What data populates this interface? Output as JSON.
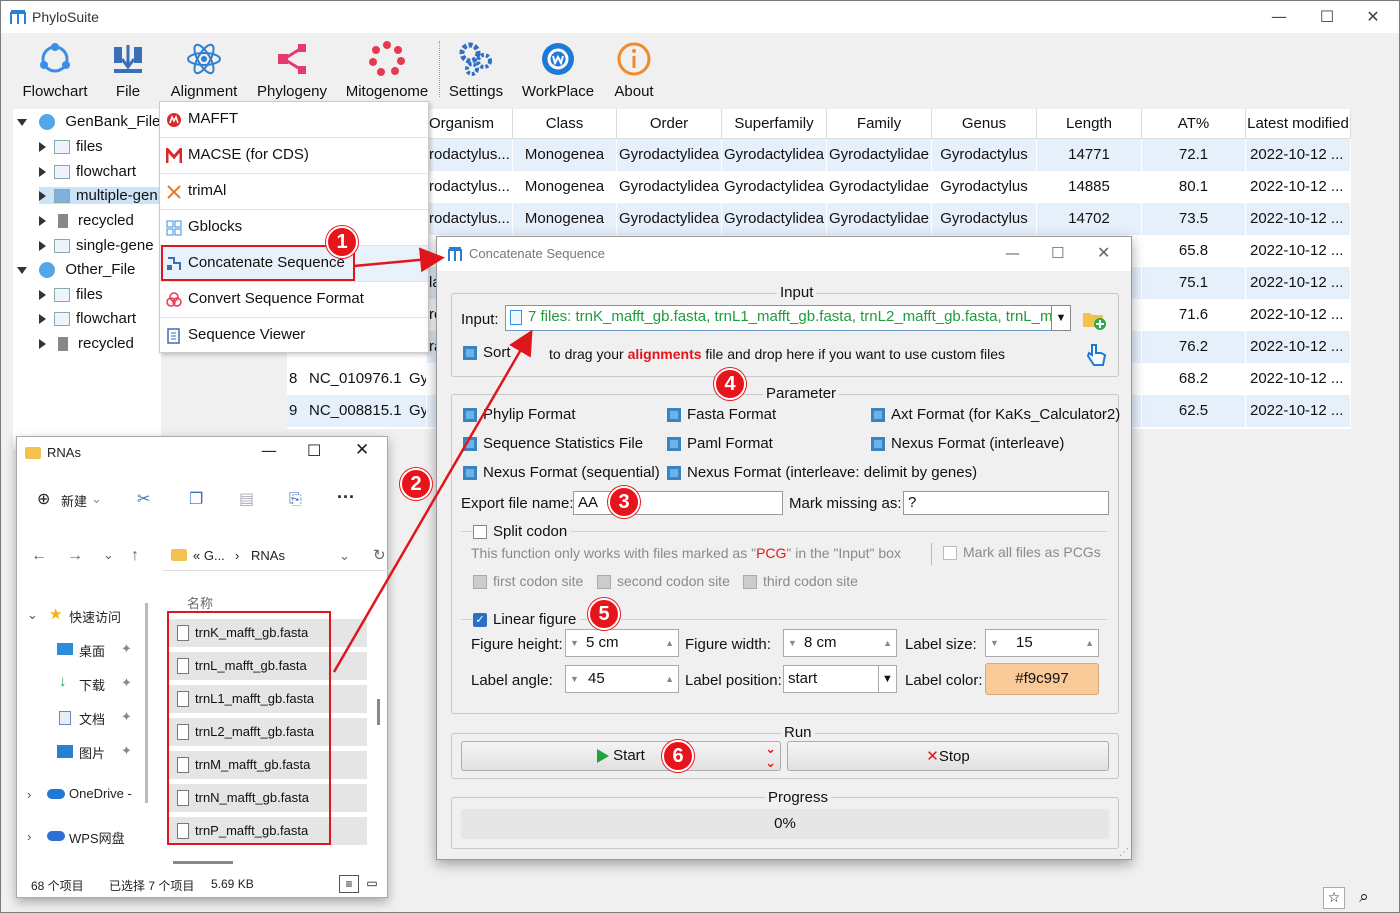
{
  "app": {
    "title": "PhyloSuite"
  },
  "toolbar": {
    "items": [
      {
        "label": "Flowchart",
        "icon": "flowchart-icon"
      },
      {
        "label": "File",
        "icon": "file-icon"
      },
      {
        "label": "Alignment",
        "icon": "alignment-icon"
      },
      {
        "label": "Phylogeny",
        "icon": "phylogeny-icon"
      },
      {
        "label": "Mitogenome",
        "icon": "mitogenome-icon"
      },
      {
        "label": "Settings",
        "icon": "settings-icon"
      },
      {
        "label": "WorkPlace",
        "icon": "workplace-icon"
      },
      {
        "label": "About",
        "icon": "about-icon"
      }
    ]
  },
  "tree": {
    "genbank": "GenBank_File",
    "genbank_children": [
      "files",
      "flowchart",
      "multiple-gen",
      "recycled",
      "single-gene"
    ],
    "other": "Other_File",
    "other_children": [
      "files",
      "flowchart",
      "recycled"
    ]
  },
  "menu": {
    "items": [
      "MAFFT",
      "MACSE (for CDS)",
      "trimAl",
      "Gblocks",
      "Concatenate Sequence",
      "Convert Sequence Format",
      "Sequence Viewer"
    ]
  },
  "table": {
    "headers": [
      "Organism",
      "Class",
      "Order",
      "Superfamily",
      "Family",
      "Genus",
      "Length",
      "AT%",
      "Latest modified"
    ],
    "rows": [
      [
        "rodactylus...",
        "Monogenea",
        "Gyrodactylidea",
        "Gyrodactylidea",
        "Gyrodactylidae",
        "Gyrodactylus",
        "14771",
        "72.1",
        "2022-10-12 ..."
      ],
      [
        "rodactylus...",
        "Monogenea",
        "Gyrodactylidea",
        "Gyrodactylidea",
        "Gyrodactylidae",
        "Gyrodactylus",
        "14885",
        "80.1",
        "2022-10-12 ..."
      ],
      [
        "rodactylus...",
        "Monogenea",
        "Gyrodactylidea",
        "Gyrodactylidea",
        "Gyrodactylidae",
        "Gyrodactylus",
        "14702",
        "73.5",
        "2022-10-12 ..."
      ],
      [
        "",
        "",
        "",
        "",
        "",
        "",
        "",
        "65.8",
        "2022-10-12 ..."
      ],
      [
        "la",
        "",
        "",
        "",
        "",
        "",
        "",
        "75.1",
        "2022-10-12 ..."
      ],
      [
        "ro",
        "",
        "",
        "",
        "",
        "",
        "",
        "71.6",
        "2022-10-12 ..."
      ],
      [
        "ra",
        "",
        "",
        "",
        "",
        "",
        "",
        "76.2",
        "2022-10-12 ..."
      ],
      [
        "",
        "",
        "",
        "",
        "",
        "",
        "",
        "68.2",
        "2022-10-12 ..."
      ],
      [
        "",
        "",
        "",
        "",
        "",
        "",
        "",
        "62.5",
        "2022-10-12 ..."
      ]
    ],
    "left_rows": [
      {
        "num": "8",
        "id": "NC_010976.1",
        "org": "Gyro"
      },
      {
        "num": "9",
        "id": "NC_008815.1",
        "org": "Gyro"
      }
    ]
  },
  "explorer": {
    "title": "RNAs",
    "new_label": "新建",
    "path_prefix": "« G...",
    "path_sep": "›",
    "path_folder": "RNAs",
    "column": "名称",
    "nav": [
      "快速访问",
      "桌面",
      "下载",
      "文档",
      "图片",
      "OneDrive -",
      "WPS网盘"
    ],
    "files": [
      "trnK_mafft_gb.fasta",
      "trnL_mafft_gb.fasta",
      "trnL1_mafft_gb.fasta",
      "trnL2_mafft_gb.fasta",
      "trnM_mafft_gb.fasta",
      "trnN_mafft_gb.fasta",
      "trnP_mafft_gb.fasta"
    ],
    "status_count": "68 个项目",
    "status_selected": "已选择 7 个项目",
    "status_size": "5.69 KB"
  },
  "dialog": {
    "title": "Concatenate Sequence",
    "input_group": "Input",
    "input_label": "Input:",
    "input_value": "7 files: trnK_mafft_gb.fasta, trnL1_mafft_gb.fasta, trnL2_mafft_gb.fasta, trnL_m",
    "sort_label": "Sort",
    "drag_hint_a": "to drag your",
    "drag_hint_b": "alignments",
    "drag_hint_c": "file and drop here if you want to use custom files",
    "param_group": "Parameter",
    "formats": [
      "Phylip Format",
      "Fasta Format",
      "Axt Format (for KaKs_Calculator2)",
      "Sequence Statistics File",
      "Paml Format",
      "Nexus Format (interleave)",
      "Nexus Format (sequential)",
      "Nexus Format (interleave: delimit by genes)"
    ],
    "export_label": "Export file name:",
    "export_value": "AA",
    "missing_label": "Mark missing as:",
    "missing_value": "?",
    "split_codon": "Split codon",
    "split_note_a": "This function only works with files marked as \"",
    "split_note_pcg": "PCG",
    "split_note_b": "\" in the \"Input\" box",
    "mark_all": "Mark all files as PCGs",
    "codon_sites": [
      "first codon site",
      "second codon site",
      "third codon site"
    ],
    "linear_figure": "Linear figure",
    "fig_height_label": "Figure height:",
    "fig_height": "5 cm",
    "fig_width_label": "Figure width:",
    "fig_width": "8 cm",
    "label_size_label": "Label size:",
    "label_size": "15",
    "label_angle_label": "Label angle:",
    "label_angle": "45",
    "label_pos_label": "Label position:",
    "label_pos": "start",
    "label_color_label": "Label color:",
    "label_color": "#f9c997",
    "run_group": "Run",
    "start": "Start",
    "stop": "Stop",
    "progress_group": "Progress",
    "progress": "0%",
    "progress_value": 0
  },
  "badges": [
    "1",
    "2",
    "3",
    "4",
    "5",
    "6"
  ],
  "colors": {
    "accent_red": "#e0161d",
    "label_color_swatch": "#f9c997",
    "row_alt": "#e6f0fb"
  }
}
